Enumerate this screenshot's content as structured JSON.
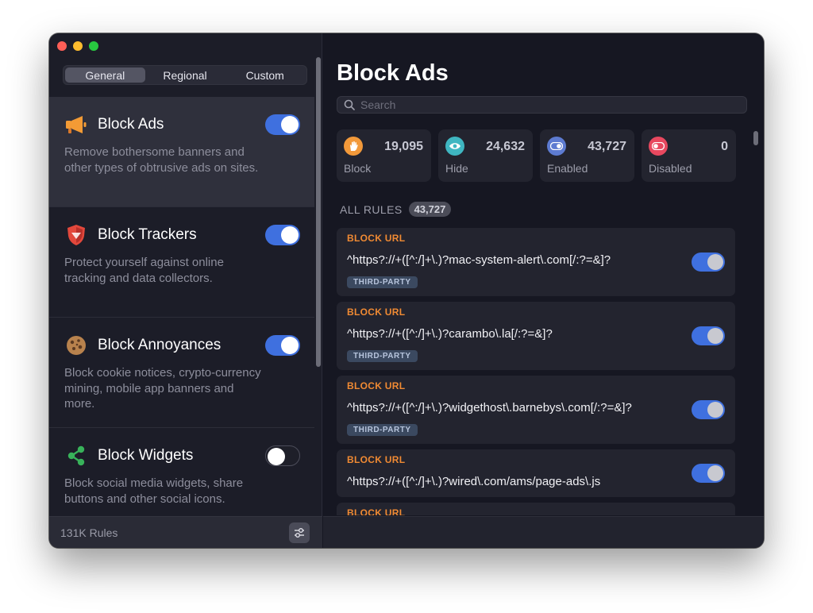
{
  "sidebar": {
    "tabs": [
      "General",
      "Regional",
      "Custom"
    ],
    "active_tab": "General",
    "items": [
      {
        "title": "Block Ads",
        "description": "Remove bothersome banners and other types of obtrusive ads on sites.",
        "enabled": true,
        "icon": "megaphone-icon",
        "selected": true
      },
      {
        "title": "Block Trackers",
        "description": "Protect yourself against online tracking and data collectors.",
        "enabled": true,
        "icon": "shield-icon",
        "selected": false
      },
      {
        "title": "Block Annoyances",
        "description": "Block cookie notices, crypto-currency mining, mobile app banners and more.",
        "enabled": true,
        "icon": "cookie-icon",
        "selected": false
      },
      {
        "title": "Block Widgets",
        "description": "Block social media widgets, share buttons and other social icons.",
        "enabled": false,
        "icon": "share-icon",
        "selected": false
      }
    ],
    "footer_text": "131K Rules"
  },
  "main": {
    "title": "Block Ads",
    "search_placeholder": "Search",
    "stats": [
      {
        "label": "Block",
        "value": "19,095",
        "icon": "hand-icon",
        "color": "#f2993a"
      },
      {
        "label": "Hide",
        "value": "24,632",
        "icon": "eye-icon",
        "color": "#3fb6c1"
      },
      {
        "label": "Enabled",
        "value": "43,727",
        "icon": "toggle-on-icon",
        "color": "#5d7bd1"
      },
      {
        "label": "Disabled",
        "value": "0",
        "icon": "toggle-off-icon",
        "color": "#e8485f"
      }
    ],
    "all_rules_label": "ALL RULES",
    "all_rules_count": "43,727",
    "rules": [
      {
        "type": "BLOCK URL",
        "pattern": "^https?://+([^:/]+\\.)?mac-system-alert\\.com[/:?=&]?",
        "tag": "THIRD-PARTY",
        "enabled": true
      },
      {
        "type": "BLOCK URL",
        "pattern": "^https?://+([^:/]+\\.)?carambo\\.la[/:?=&]?",
        "tag": "THIRD-PARTY",
        "enabled": true
      },
      {
        "type": "BLOCK URL",
        "pattern": "^https?://+([^:/]+\\.)?widgethost\\.barnebys\\.com[/:?=&]?",
        "tag": "THIRD-PARTY",
        "enabled": true
      },
      {
        "type": "BLOCK URL",
        "pattern": "^https?://+([^:/]+\\.)?wired\\.com/ams/page-ads\\.js",
        "tag": "",
        "enabled": true
      },
      {
        "type": "BLOCK URL",
        "pattern": "",
        "tag": "",
        "enabled": true
      }
    ]
  },
  "colors": {
    "accent": "#3f70df",
    "rule_type": "#f08a33",
    "window_bg": "#161722"
  }
}
